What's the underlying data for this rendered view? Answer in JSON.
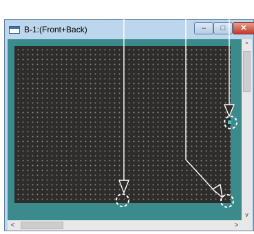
{
  "window": {
    "title": "B-1:(Front+Back)",
    "controls": {
      "minimize": "–",
      "maximize": "□",
      "close": "✕"
    }
  },
  "scrollbars": {
    "vertical": {
      "up": "^",
      "down": "v"
    },
    "horizontal": {
      "left": "<",
      "right": ">"
    }
  },
  "colors": {
    "canvas": "#2f2d2c",
    "border_area": "#3b8b8d",
    "annotation": "#ffffff"
  },
  "icons": [
    "window-icon",
    "minimize-icon",
    "maximize-icon",
    "close-icon",
    "annotation-arrow-icon",
    "dashed-circle-marker-icon"
  ]
}
